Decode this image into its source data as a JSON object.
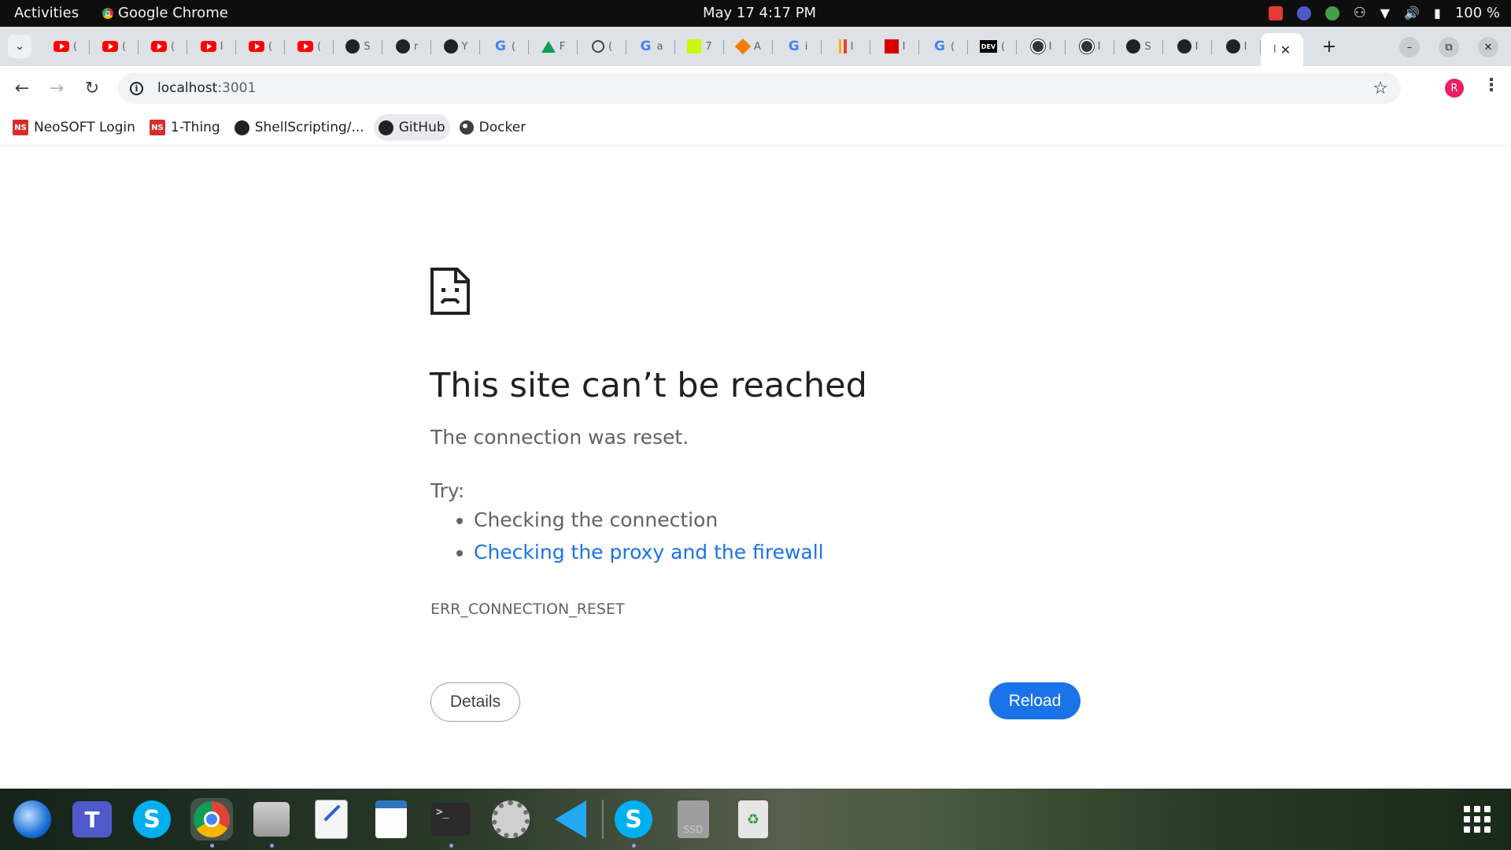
{
  "topbar": {
    "activities": "Activities",
    "app_name": "Google Chrome",
    "clock": "May 17  4:17 PM",
    "battery": "100 %"
  },
  "tabs": [
    {
      "icon": "youtube-icon",
      "trail": "("
    },
    {
      "icon": "youtube-icon",
      "trail": "("
    },
    {
      "icon": "youtube-icon",
      "trail": "("
    },
    {
      "icon": "youtube-icon",
      "trail": "I"
    },
    {
      "icon": "youtube-icon",
      "trail": "("
    },
    {
      "icon": "youtube-icon",
      "trail": "("
    },
    {
      "icon": "github-icon",
      "trail": "S"
    },
    {
      "icon": "github-icon",
      "trail": "r"
    },
    {
      "icon": "github-icon",
      "trail": "Y"
    },
    {
      "icon": "google-icon",
      "trail": "("
    },
    {
      "icon": "drive-icon",
      "trail": "F"
    },
    {
      "icon": "openai-icon",
      "trail": "("
    },
    {
      "icon": "google-icon",
      "trail": "a"
    },
    {
      "icon": "lime-app-icon",
      "trail": "7"
    },
    {
      "icon": "box-icon",
      "trail": "A"
    },
    {
      "icon": "google-icon",
      "trail": "i"
    },
    {
      "icon": "bars-icon",
      "trail": "I"
    },
    {
      "icon": "red-square-icon",
      "trail": "I"
    },
    {
      "icon": "google-icon",
      "trail": "("
    },
    {
      "icon": "dev-icon",
      "trail": "("
    },
    {
      "icon": "circle-app-icon",
      "trail": "I"
    },
    {
      "icon": "circle-app-icon",
      "trail": "I"
    },
    {
      "icon": "github-icon",
      "trail": "S"
    },
    {
      "icon": "github-icon",
      "trail": "I"
    },
    {
      "icon": "github-icon",
      "trail": "I"
    }
  ],
  "active_tab": {
    "trail": "I"
  },
  "omnibox": {
    "host": "localhost",
    "rest": ":3001"
  },
  "avatar_letter": "R",
  "bookmarks": [
    {
      "label": "NeoSOFT Login",
      "icon": "ns"
    },
    {
      "label": "1-Thing",
      "icon": "ns"
    },
    {
      "label": "ShellScripting/...",
      "icon": "github"
    },
    {
      "label": "GitHub",
      "icon": "github"
    },
    {
      "label": "Docker",
      "icon": "globe"
    }
  ],
  "bookmark_ns_text": "NS",
  "error": {
    "title": "This site can’t be reached",
    "subtitle": "The connection was reset.",
    "try_label": "Try:",
    "suggestions": [
      "Checking the connection",
      "Checking the proxy and the firewall"
    ],
    "code": "ERR_CONNECTION_RESET",
    "details_label": "Details",
    "reload_label": "Reload"
  },
  "dock": {
    "ssd_label": "SSD",
    "terminal_prompt": ">_"
  },
  "colors": {
    "accent_blue": "#1a73e8",
    "link_blue": "#1a73e8",
    "topbar": "#0e0e0e",
    "tabstrip": "#dee1e6"
  }
}
